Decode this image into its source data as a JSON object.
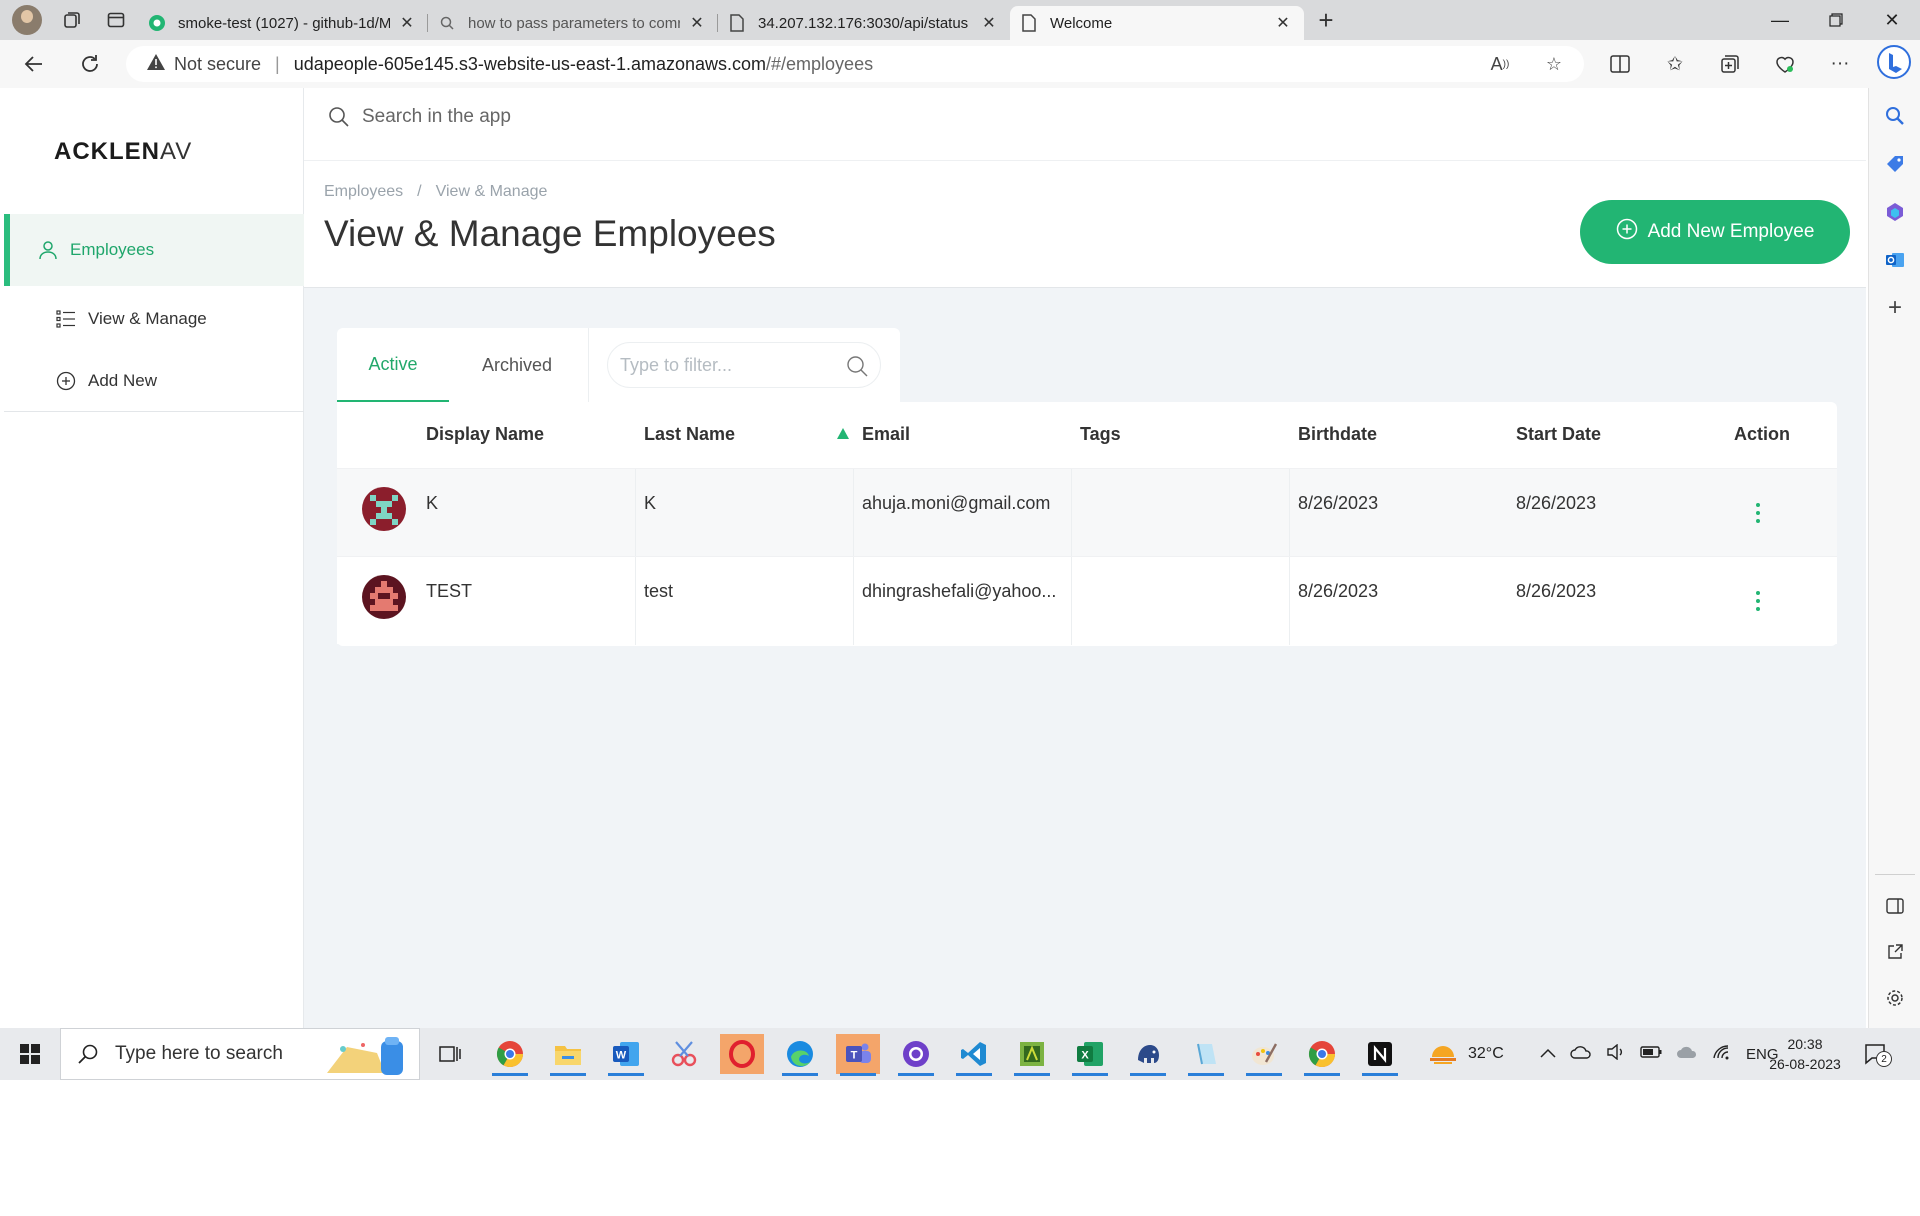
{
  "browser": {
    "tabs": [
      {
        "title": "smoke-test (1027) - github-1d/M",
        "icon": "circleci-icon"
      },
      {
        "title": "how to pass parameters to comr",
        "icon": "search-icon"
      },
      {
        "title": "34.207.132.176:3030/api/status",
        "icon": "document-icon"
      },
      {
        "title": "Welcome",
        "icon": "document-icon",
        "active": true
      }
    ],
    "not_secure": "Not secure",
    "url_host": "udapeople-605e145.s3-website-us-east-1.amazonaws.com",
    "url_path": "/#/employees"
  },
  "sidebar": {
    "logo_main": "ACKLEN",
    "logo_faded": "AV",
    "items": [
      {
        "label": "Employees",
        "icon": "user-icon"
      },
      {
        "label": "View & Manage",
        "icon": "list-icon"
      },
      {
        "label": "Add New",
        "icon": "plus-circle-icon"
      }
    ]
  },
  "search": {
    "placeholder": "Search in the app"
  },
  "header": {
    "breadcrumb": [
      "Employees",
      "/",
      "View & Manage"
    ],
    "title": "View & Manage Employees",
    "add_button": "Add New Employee"
  },
  "tabs": {
    "active": "Active",
    "archived": "Archived"
  },
  "filter": {
    "placeholder": "Type to filter..."
  },
  "table": {
    "columns": [
      "Display Name",
      "Last Name",
      "Email",
      "Tags",
      "Birthdate",
      "Start Date",
      "Action"
    ],
    "rows": [
      {
        "display_name": "K",
        "last_name": "K",
        "email": "ahuja.moni@gmail.com",
        "tags": "",
        "birthdate": "8/26/2023",
        "start_date": "8/26/2023"
      },
      {
        "display_name": "TEST",
        "last_name": "test",
        "email": "dhingrashefali@yahoo...",
        "tags": "",
        "birthdate": "8/26/2023",
        "start_date": "8/26/2023"
      }
    ]
  },
  "taskbar": {
    "search_placeholder": "Type here to search",
    "weather": "32°C",
    "language": "ENG",
    "time": "20:38",
    "date": "26-08-2023",
    "notifications": "2"
  },
  "colors": {
    "accent": "#22b573",
    "accent_text": "#1fa66b"
  }
}
